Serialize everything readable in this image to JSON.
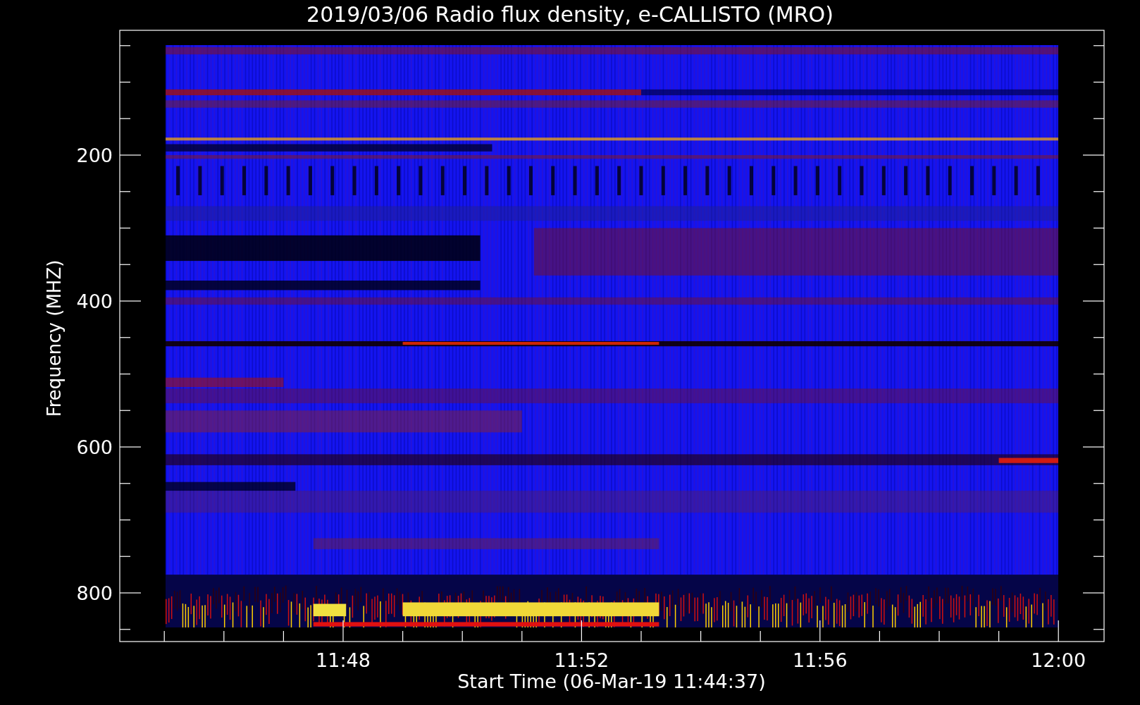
{
  "title": "2019/03/06  Radio flux density, e-CALLISTO (MRO)",
  "y_axis": {
    "label": "Frequency (MHZ)",
    "ticks": [
      "200",
      "400",
      "600",
      "800"
    ]
  },
  "x_axis": {
    "label": "Start Time (06-Mar-19 11:44:37)",
    "ticks": [
      "11:48",
      "11:52",
      "11:56",
      "12:00"
    ]
  }
}
